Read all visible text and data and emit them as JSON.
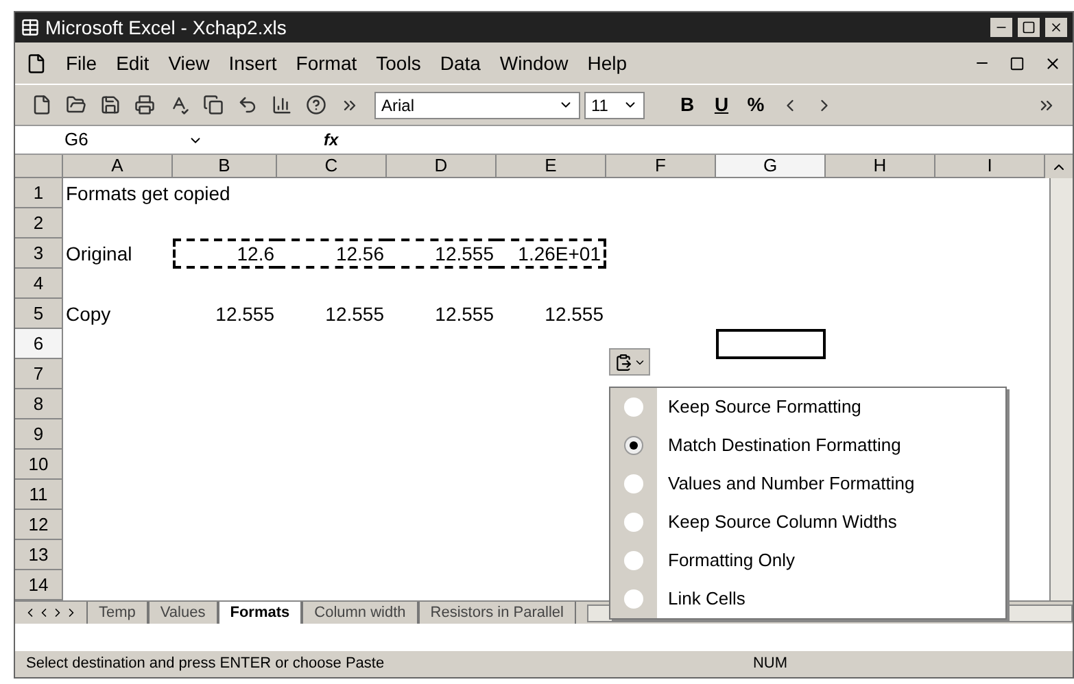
{
  "window": {
    "title": "Microsoft Excel - Xchap2.xls"
  },
  "menu": [
    "File",
    "Edit",
    "View",
    "Insert",
    "Format",
    "Tools",
    "Data",
    "Window",
    "Help"
  ],
  "toolbar": {
    "font": "Arial",
    "size": "11",
    "format_buttons": [
      "B",
      "U",
      "%"
    ]
  },
  "formula_bar": {
    "name_box": "G6",
    "function_label": "fx"
  },
  "columns": [
    {
      "label": "A",
      "selected": false
    },
    {
      "label": "B",
      "selected": false
    },
    {
      "label": "C",
      "selected": false
    },
    {
      "label": "D",
      "selected": false
    },
    {
      "label": "E",
      "selected": false
    },
    {
      "label": "F",
      "selected": false
    },
    {
      "label": "G",
      "selected": true
    },
    {
      "label": "H",
      "selected": false
    },
    {
      "label": "I",
      "selected": false
    }
  ],
  "rows": [
    {
      "number": "1",
      "selected": false,
      "marquee": false,
      "cells": {
        "A": {
          "text": "Formats get copied",
          "kind": "text"
        }
      }
    },
    {
      "number": "2",
      "selected": false,
      "marquee": false,
      "cells": {}
    },
    {
      "number": "3",
      "selected": false,
      "marquee": true,
      "cells": {
        "A": {
          "text": "Original",
          "kind": "text"
        },
        "B": {
          "text": "12.6",
          "kind": "number"
        },
        "C": {
          "text": "12.56",
          "kind": "number"
        },
        "D": {
          "text": "12.555",
          "kind": "number"
        },
        "E": {
          "text": "1.26E+01",
          "kind": "number"
        }
      }
    },
    {
      "number": "4",
      "selected": false,
      "marquee": false,
      "cells": {}
    },
    {
      "number": "5",
      "selected": false,
      "marquee": false,
      "cells": {
        "A": {
          "text": "Copy",
          "kind": "text"
        },
        "B": {
          "text": "12.555",
          "kind": "number"
        },
        "C": {
          "text": "12.555",
          "kind": "number"
        },
        "D": {
          "text": "12.555",
          "kind": "number"
        },
        "E": {
          "text": "12.555",
          "kind": "number"
        }
      }
    },
    {
      "number": "6",
      "selected": true,
      "marquee": false,
      "cells": {}
    },
    {
      "number": "7",
      "selected": false,
      "marquee": false,
      "cells": {}
    },
    {
      "number": "8",
      "selected": false,
      "marquee": false,
      "cells": {}
    },
    {
      "number": "9",
      "selected": false,
      "marquee": false,
      "cells": {}
    },
    {
      "number": "10",
      "selected": false,
      "marquee": false,
      "cells": {}
    },
    {
      "number": "11",
      "selected": false,
      "marquee": false,
      "cells": {}
    },
    {
      "number": "12",
      "selected": false,
      "marquee": false,
      "cells": {}
    },
    {
      "number": "13",
      "selected": false,
      "marquee": false,
      "cells": {}
    },
    {
      "number": "14",
      "selected": false,
      "marquee": false,
      "cells": {}
    }
  ],
  "paste_options": {
    "items": [
      {
        "label": "Keep Source Formatting",
        "selected": false
      },
      {
        "label": "Match Destination Formatting",
        "selected": true
      },
      {
        "label": "Values and Number Formatting",
        "selected": false
      },
      {
        "label": "Keep Source Column Widths",
        "selected": false
      },
      {
        "label": "Formatting Only",
        "selected": false
      },
      {
        "label": "Link Cells",
        "selected": false
      }
    ]
  },
  "sheet_tabs": [
    {
      "label": "Temp",
      "selected": false
    },
    {
      "label": "Values",
      "selected": false
    },
    {
      "label": "Formats",
      "selected": true
    },
    {
      "label": "Column width",
      "selected": false
    },
    {
      "label": "Resistors in Parallel",
      "selected": false
    }
  ],
  "status_bar": {
    "message": "Select destination and press ENTER or choose Paste",
    "indicator": "NUM"
  }
}
